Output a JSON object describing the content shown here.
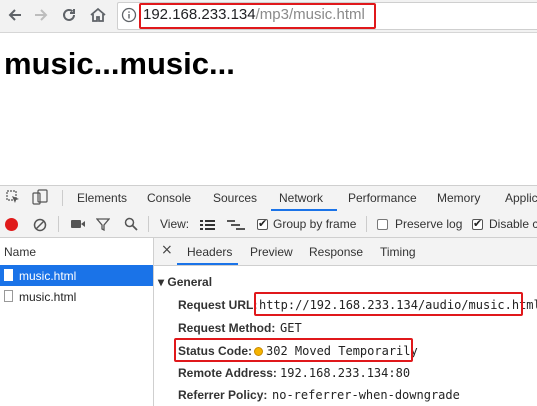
{
  "browser": {
    "url_host": "192.168.233.134",
    "url_path": "/mp3/music.html",
    "back_icon": "arrow-left-icon",
    "forward_icon": "arrow-right-icon",
    "reload_icon": "reload-icon",
    "home_icon": "home-icon",
    "info_icon": "info-icon"
  },
  "page": {
    "heading": "music...music..."
  },
  "devtools": {
    "tabs": [
      "Elements",
      "Console",
      "Sources",
      "Network",
      "Performance",
      "Memory",
      "Applic"
    ],
    "active_tab": "Network",
    "toolbar": {
      "view_label": "View:",
      "group_by_frame": "Group by frame",
      "preserve_log": "Preserve log",
      "disable_cache": "Disable c"
    },
    "requests_header": "Name",
    "requests": [
      "music.html",
      "music.html"
    ],
    "detail_tabs": [
      "Headers",
      "Preview",
      "Response",
      "Timing"
    ],
    "close_glyph": "×",
    "general_section": "▾ General",
    "general": {
      "request_url_key": "Request URL:",
      "request_url_val": "http://192.168.233.134/audio/music.html",
      "request_method_key": "Request Method:",
      "request_method_val": "GET",
      "status_code_key": "Status Code:",
      "status_code_val": "302 Moved Temporarily",
      "remote_address_key": "Remote Address:",
      "remote_address_val": "192.168.233.134:80",
      "referrer_policy_key": "Referrer Policy:",
      "referrer_policy_val": "no-referrer-when-downgrade"
    },
    "colors": {
      "highlight": "#e0181b",
      "selected": "#1a73e8",
      "status_dot": "#f5b400"
    }
  }
}
